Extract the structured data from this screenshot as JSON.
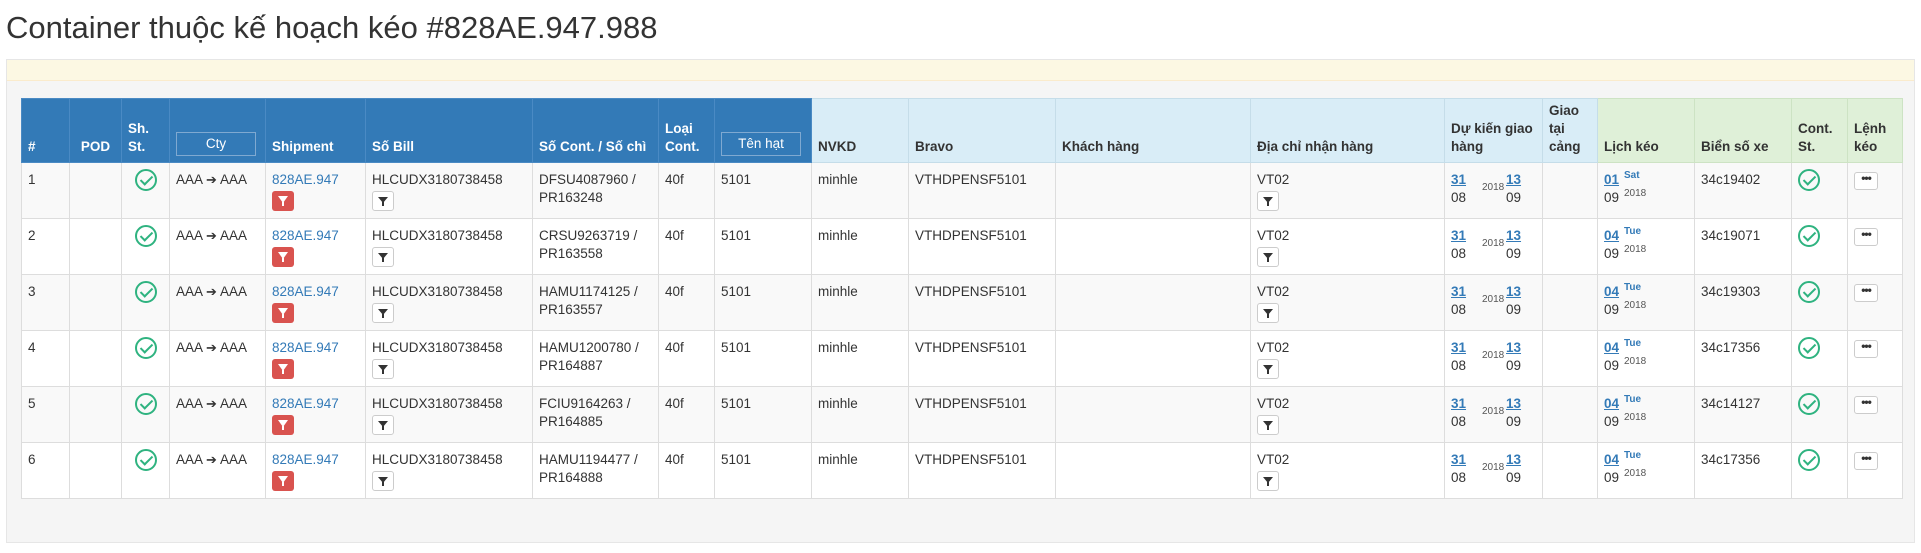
{
  "page": {
    "title": "Container thuộc kế hoạch kéo #828AE.947.988"
  },
  "table": {
    "headers": {
      "num": "#",
      "pod": "POD",
      "sh_st": "Sh. St.",
      "cty": "Cty",
      "shipment": "Shipment",
      "so_bill": "Số Bill",
      "so_cont": "Số Cont. / Số chì",
      "loai_cont": "Loại Cont.",
      "ten_hat": "Tên hạt",
      "nvkd": "NVKD",
      "bravo": "Bravo",
      "khach_hang": "Khách hàng",
      "dia_chi": "Địa chỉ nhận hàng",
      "du_kien": "Dự kiến giao hàng",
      "giao_tai_cang": "Giao tại cảng",
      "lich_keo": "Lịch kéo",
      "bien_so": "Biển số xe",
      "cont_st": "Cont. St.",
      "lenh_keo": "Lệnh kéo"
    },
    "rows": [
      {
        "num": "1",
        "pod": "",
        "cty_from": "AAA",
        "cty_to": "AAA",
        "shipment": "828AE.947",
        "bill": "HLCUDX3180738458",
        "cont": "DFSU4087960 /",
        "seal": "PR163248",
        "loai": "40f",
        "ten_hat": "5101",
        "nvkd": "minhle",
        "bravo": "VTHDPENSF5101",
        "khach": "",
        "dia_chi": "VT02",
        "dk_d1": "31",
        "dk_m1": "08",
        "dk_y": "2018",
        "dk_d2": "13",
        "dk_m2": "09",
        "giao": "",
        "lk_d": "01",
        "lk_dow": "Sat",
        "lk_m": "09",
        "lk_y": "2018",
        "bien": "34c19402",
        "more": "•••"
      },
      {
        "num": "2",
        "pod": "",
        "cty_from": "AAA",
        "cty_to": "AAA",
        "shipment": "828AE.947",
        "bill": "HLCUDX3180738458",
        "cont": "CRSU9263719 /",
        "seal": "PR163558",
        "loai": "40f",
        "ten_hat": "5101",
        "nvkd": "minhle",
        "bravo": "VTHDPENSF5101",
        "khach": "",
        "dia_chi": "VT02",
        "dk_d1": "31",
        "dk_m1": "08",
        "dk_y": "2018",
        "dk_d2": "13",
        "dk_m2": "09",
        "giao": "",
        "lk_d": "04",
        "lk_dow": "Tue",
        "lk_m": "09",
        "lk_y": "2018",
        "bien": "34c19071",
        "more": "•••"
      },
      {
        "num": "3",
        "pod": "",
        "cty_from": "AAA",
        "cty_to": "AAA",
        "shipment": "828AE.947",
        "bill": "HLCUDX3180738458",
        "cont": "HAMU1174125 /",
        "seal": "PR163557",
        "loai": "40f",
        "ten_hat": "5101",
        "nvkd": "minhle",
        "bravo": "VTHDPENSF5101",
        "khach": "",
        "dia_chi": "VT02",
        "dk_d1": "31",
        "dk_m1": "08",
        "dk_y": "2018",
        "dk_d2": "13",
        "dk_m2": "09",
        "giao": "",
        "lk_d": "04",
        "lk_dow": "Tue",
        "lk_m": "09",
        "lk_y": "2018",
        "bien": "34c19303",
        "more": "•••"
      },
      {
        "num": "4",
        "pod": "",
        "cty_from": "AAA",
        "cty_to": "AAA",
        "shipment": "828AE.947",
        "bill": "HLCUDX3180738458",
        "cont": "HAMU1200780 /",
        "seal": "PR164887",
        "loai": "40f",
        "ten_hat": "5101",
        "nvkd": "minhle",
        "bravo": "VTHDPENSF5101",
        "khach": "",
        "dia_chi": "VT02",
        "dk_d1": "31",
        "dk_m1": "08",
        "dk_y": "2018",
        "dk_d2": "13",
        "dk_m2": "09",
        "giao": "",
        "lk_d": "04",
        "lk_dow": "Tue",
        "lk_m": "09",
        "lk_y": "2018",
        "bien": "34c17356",
        "more": "•••"
      },
      {
        "num": "5",
        "pod": "",
        "cty_from": "AAA",
        "cty_to": "AAA",
        "shipment": "828AE.947",
        "bill": "HLCUDX3180738458",
        "cont": "FCIU9164263 /",
        "seal": "PR164885",
        "loai": "40f",
        "ten_hat": "5101",
        "nvkd": "minhle",
        "bravo": "VTHDPENSF5101",
        "khach": "",
        "dia_chi": "VT02",
        "dk_d1": "31",
        "dk_m1": "08",
        "dk_y": "2018",
        "dk_d2": "13",
        "dk_m2": "09",
        "giao": "",
        "lk_d": "04",
        "lk_dow": "Tue",
        "lk_m": "09",
        "lk_y": "2018",
        "bien": "34c14127",
        "more": "•••"
      },
      {
        "num": "6",
        "pod": "",
        "cty_from": "AAA",
        "cty_to": "AAA",
        "shipment": "828AE.947",
        "bill": "HLCUDX3180738458",
        "cont": "HAMU1194477 /",
        "seal": "PR164888",
        "loai": "40f",
        "ten_hat": "5101",
        "nvkd": "minhle",
        "bravo": "VTHDPENSF5101",
        "khach": "",
        "dia_chi": "VT02",
        "dk_d1": "31",
        "dk_m1": "08",
        "dk_y": "2018",
        "dk_d2": "13",
        "dk_m2": "09",
        "giao": "",
        "lk_d": "04",
        "lk_dow": "Tue",
        "lk_m": "09",
        "lk_y": "2018",
        "bien": "34c17356",
        "more": "•••"
      }
    ]
  },
  "colors": {
    "header_blue": "#337ab7",
    "header_light_blue": "#d9edf7",
    "header_green": "#dff0d8",
    "check_green": "#2fb380",
    "filter_red": "#d9534f",
    "link_blue": "#337ab7"
  },
  "icons": {
    "status": "check-circle-icon",
    "arrow": "arrow-right-icon",
    "filter": "filter-icon",
    "more": "ellipsis-icon"
  }
}
